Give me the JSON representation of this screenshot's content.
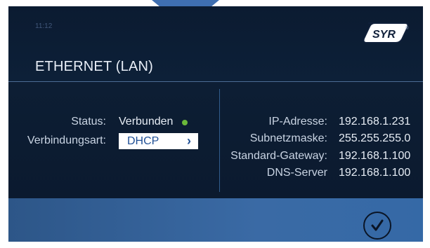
{
  "header": {
    "time": "11:12",
    "logo_text": "SYR",
    "logo_registered": "®",
    "title": "ETHERNET (LAN)"
  },
  "left": {
    "status_label": "Status:",
    "status_value": "Verbunden",
    "status_color": "#6bb83a",
    "type_label": "Verbindungsart:",
    "type_value": "DHCP",
    "type_chevron": "›"
  },
  "right": {
    "rows": [
      {
        "label": "IP-Adresse:",
        "value": "192.168.1.231"
      },
      {
        "label": "Subnetzmaske:",
        "value": "255.255.255.0"
      },
      {
        "label": "Standard-Gateway:",
        "value": "192.168.1.100"
      },
      {
        "label": "DNS-Server",
        "value": "192.168.1.100"
      }
    ]
  },
  "footer": {
    "confirm_icon": "checkmark-circle-icon"
  },
  "colors": {
    "background": "#0c1c33",
    "accent": "#3a6aa5",
    "button_text": "#1f4f95"
  }
}
